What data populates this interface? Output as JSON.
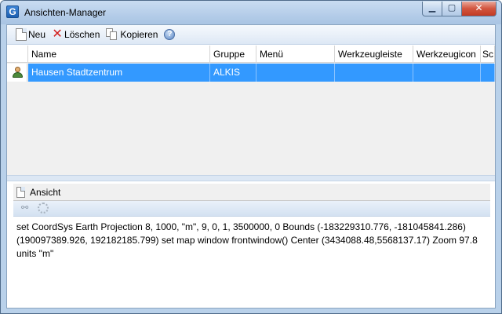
{
  "window": {
    "title": "Ansichten-Manager",
    "app_icon_letter": "G",
    "minimize_glyph": "▁",
    "maximize_glyph": "▢",
    "close_glyph": "✕"
  },
  "toolbar": {
    "new_label": "Neu",
    "delete_label": "Löschen",
    "copy_label": "Kopieren",
    "help_glyph": "?"
  },
  "grid": {
    "columns": [
      "Name",
      "Gruppe",
      "Menü",
      "Werkzeugleiste",
      "Werkzeugicon",
      "Sc"
    ],
    "rows": [
      {
        "icon": "user-icon",
        "cells": [
          "Hausen Stadtzentrum",
          "ALKIS",
          "",
          "",
          "",
          ""
        ]
      }
    ],
    "selection_color": "#3399ff"
  },
  "detail": {
    "tab_label": "Ansicht",
    "link_glyph": "⚯",
    "editor_text": "set CoordSys Earth Projection 8, 1000, \"m\", 9, 0, 1, 3500000, 0 Bounds (-183229310.776, -181045841.286) (190097389.926, 192182185.799) set map window frontwindow() Center (3434088.48,5568137.17) Zoom 97.8 units \"m\""
  },
  "colors": {
    "titlebar": "#b9d1ea",
    "close_button": "#c13a23",
    "delete_icon": "#d21d1d"
  }
}
